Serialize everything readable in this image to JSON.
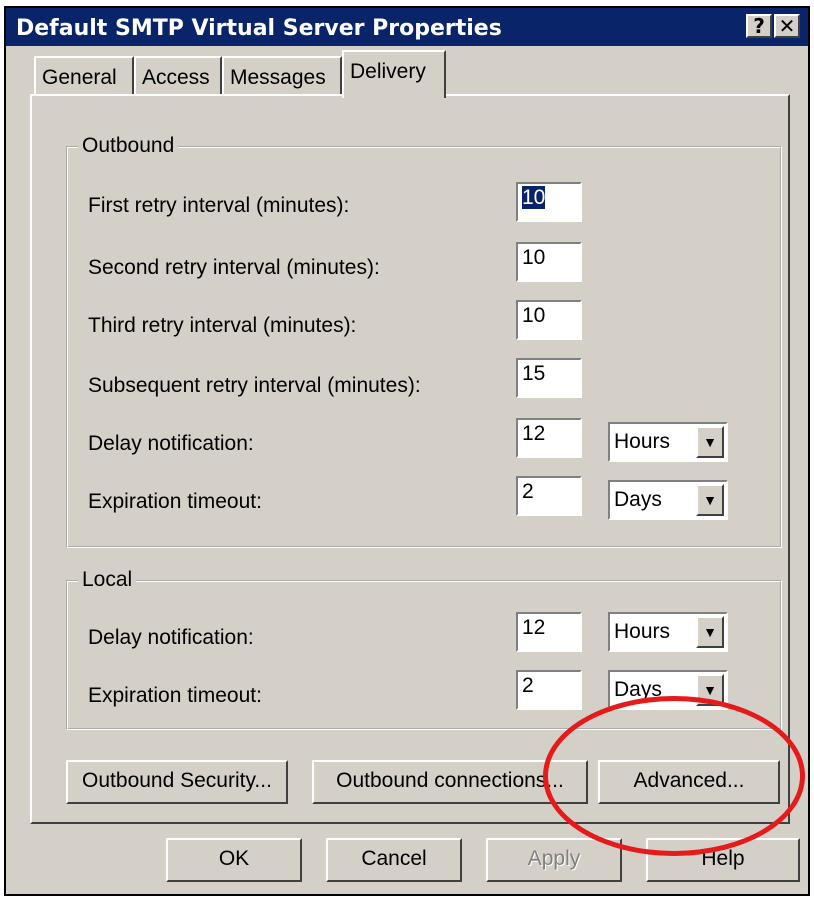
{
  "window": {
    "title": "Default SMTP Virtual Server Properties",
    "help_glyph": "?",
    "close_glyph": "✕"
  },
  "tabs": [
    {
      "label": "General"
    },
    {
      "label": "Access"
    },
    {
      "label": "Messages"
    },
    {
      "label": "Delivery"
    }
  ],
  "outbound": {
    "legend": "Outbound",
    "first_retry_label": "First retry interval (minutes):",
    "first_retry_value": "10",
    "second_retry_label": "Second retry interval (minutes):",
    "second_retry_value": "10",
    "third_retry_label": "Third retry interval (minutes):",
    "third_retry_value": "10",
    "subsequent_retry_label": "Subsequent retry interval (minutes):",
    "subsequent_retry_value": "15",
    "delay_label": "Delay notification:",
    "delay_value": "12",
    "delay_unit": "Hours",
    "expiration_label": "Expiration timeout:",
    "expiration_value": "2",
    "expiration_unit": "Days"
  },
  "local": {
    "legend": "Local",
    "delay_label": "Delay notification:",
    "delay_value": "12",
    "delay_unit": "Hours",
    "expiration_label": "Expiration timeout:",
    "expiration_value": "2",
    "expiration_unit": "Days"
  },
  "buttons": {
    "outbound_security": "Outbound Security...",
    "outbound_connections": "Outbound connections...",
    "advanced": "Advanced...",
    "ok": "OK",
    "cancel": "Cancel",
    "apply": "Apply",
    "help": "Help"
  },
  "colors": {
    "titlebar": "#0a246a",
    "dialog": "#d4d0c8",
    "annotation": "#e51a1a"
  }
}
